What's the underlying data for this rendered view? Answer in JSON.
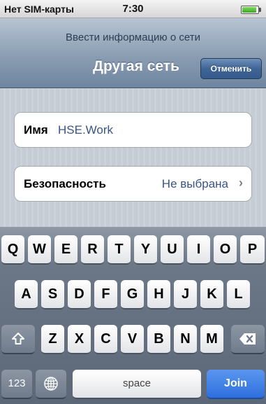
{
  "status_bar": {
    "carrier": "Нет SIM-карты",
    "time": "7:30",
    "battery_icon": "battery-full-icon"
  },
  "nav": {
    "prompt": "Ввести информацию о сети",
    "title": "Другая сеть",
    "cancel_label": "Отменить"
  },
  "form": {
    "name_label": "Имя",
    "name_value": "HSE.Work",
    "security_label": "Безопасность",
    "security_value": "Не выбрана",
    "security_chevron": "›"
  },
  "keyboard": {
    "row1": [
      "Q",
      "W",
      "E",
      "R",
      "T",
      "Y",
      "U",
      "I",
      "O",
      "P"
    ],
    "row2": [
      "A",
      "S",
      "D",
      "F",
      "G",
      "H",
      "J",
      "K",
      "L"
    ],
    "row3": [
      "Z",
      "X",
      "C",
      "V",
      "B",
      "N",
      "M"
    ],
    "shift_icon": "shift-icon",
    "delete_icon": "delete-icon",
    "numbers_label": "123",
    "globe_icon": "globe-icon",
    "space_label": "space",
    "join_label": "Join"
  },
  "colors": {
    "accent_blue": "#2d6fdd",
    "value_blue": "#385487"
  }
}
